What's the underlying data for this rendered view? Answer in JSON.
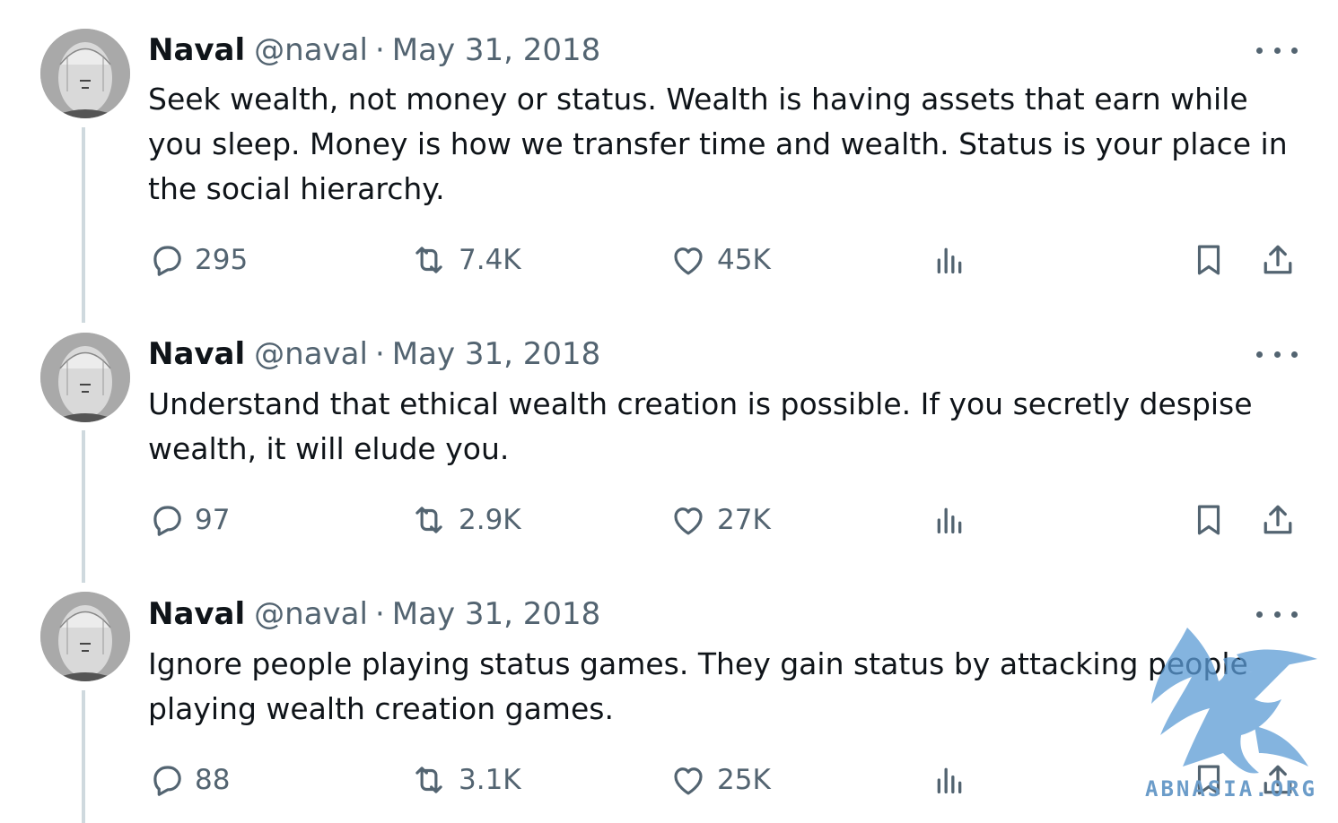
{
  "tweets": [
    {
      "author": "Naval",
      "handle": "@naval",
      "separator": "·",
      "date": "May 31, 2018",
      "text": "Seek wealth, not money or status. Wealth is having assets that earn while you sleep. Money is how we transfer time and wealth. Status is your place in the social hierarchy.",
      "replies": "295",
      "reposts": "7.4K",
      "likes": "45K"
    },
    {
      "author": "Naval",
      "handle": "@naval",
      "separator": "·",
      "date": "May 31, 2018",
      "text": "Understand that ethical wealth creation is possible. If you secretly despise wealth, it will elude you.",
      "replies": "97",
      "reposts": "2.9K",
      "likes": "27K"
    },
    {
      "author": "Naval",
      "handle": "@naval",
      "separator": "·",
      "date": "May 31, 2018",
      "text": "Ignore people playing status games. They gain status by attacking people playing wealth creation games.",
      "replies": "88",
      "reposts": "3.1K",
      "likes": "25K"
    }
  ],
  "icons": {
    "reply": "speech-bubble-icon",
    "repost": "repost-arrows-icon",
    "like": "heart-icon",
    "views": "bar-chart-icon",
    "bookmark": "bookmark-icon",
    "share": "upload-share-icon",
    "more": "ellipsis-icon"
  },
  "colors": {
    "text": "#0f1419",
    "secondary": "#536471",
    "thread_line": "#cfd9de",
    "watermark": "#6b9cc9"
  },
  "watermark": {
    "text": "ABNASIA.ORG"
  }
}
